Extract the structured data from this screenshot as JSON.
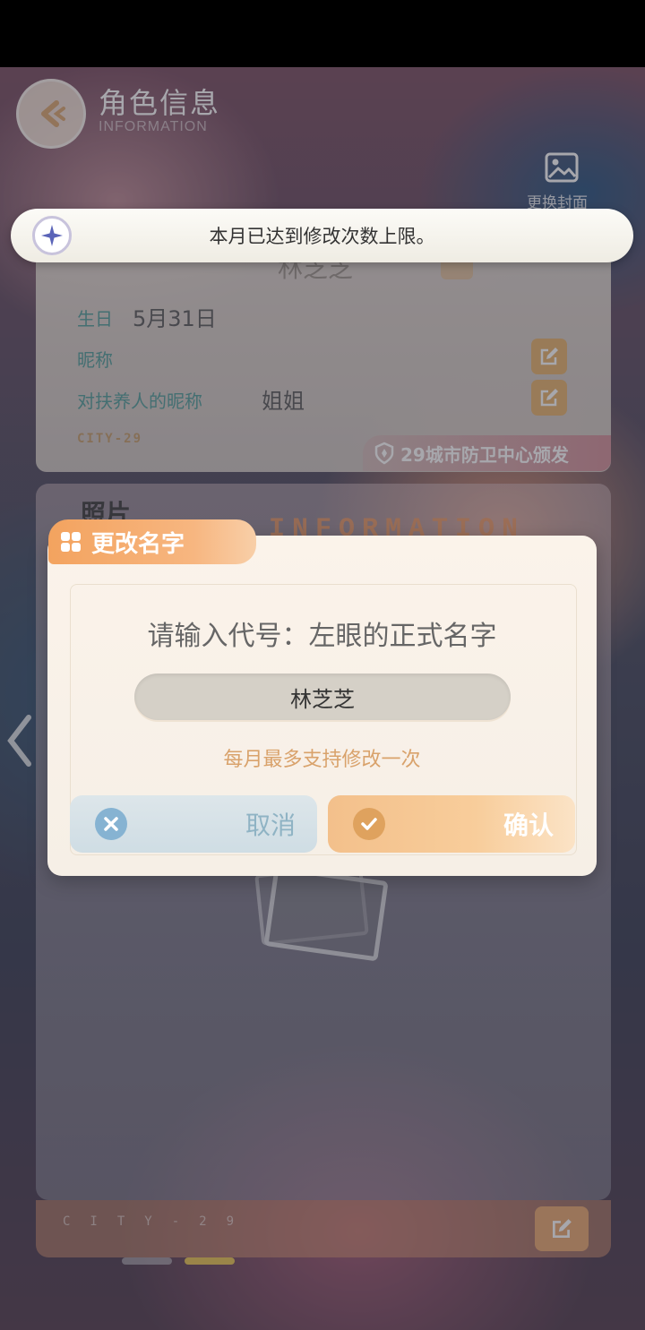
{
  "header": {
    "title": "角色信息",
    "subtitle": "INFORMATION",
    "change_cover_label": "更换封面"
  },
  "profile": {
    "name": "林芝芝",
    "rows": [
      {
        "label": "生日",
        "value": "5月31日"
      },
      {
        "label": "昵称",
        "value": ""
      },
      {
        "label": "对扶养人的昵称",
        "value": "姐姐"
      }
    ],
    "city_code": "CITY-29",
    "issuer": "29城市防卫中心颁发"
  },
  "photos": {
    "title": "照片",
    "watermark": "INFORMATION",
    "bottom_code": "CITY-29"
  },
  "toast": {
    "message": "本月已达到修改次数上限。"
  },
  "dialog": {
    "title": "更改名字",
    "prompt": "请输入代号：左眼的正式名字",
    "input_value": "林芝芝",
    "hint": "每月最多支持修改一次",
    "cancel_label": "取消",
    "confirm_label": "确认"
  },
  "pager": {
    "current": 2,
    "total": 2
  },
  "colors": {
    "accent_orange": "#f3a35f",
    "teal_label": "#4c9a95",
    "hint_gold": "#d9a26b"
  }
}
